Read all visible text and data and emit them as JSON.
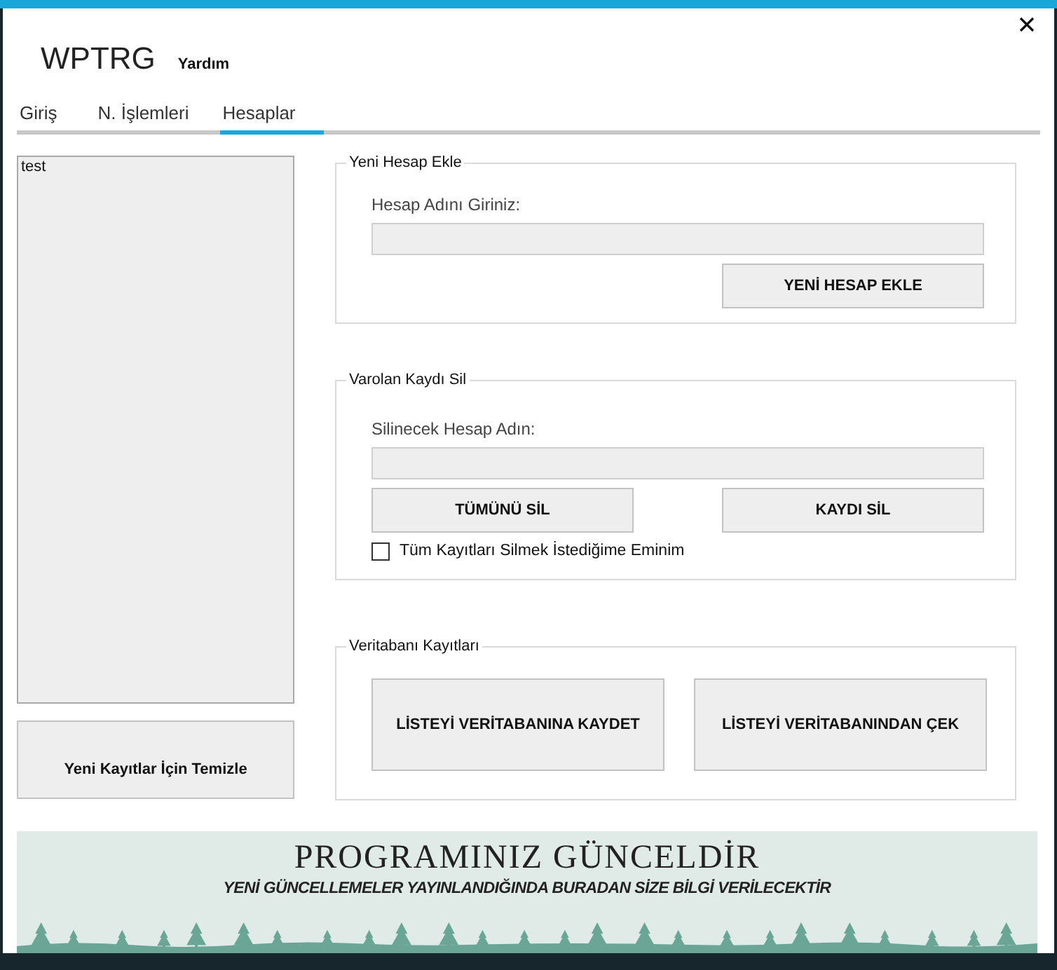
{
  "window": {
    "title": "WPTRG",
    "menu": [
      "Yardım"
    ]
  },
  "tabs": [
    {
      "label": "Giriş",
      "selected": false
    },
    {
      "label": "N. İşlemleri",
      "selected": false
    },
    {
      "label": "Hesaplar",
      "selected": true
    }
  ],
  "accounts_list": {
    "items": [
      "test"
    ]
  },
  "clear_button": "Yeni Kayıtlar İçin Temizle",
  "add_group": {
    "title": "Yeni Hesap Ekle",
    "field_label": "Hesap Adını Giriniz:",
    "button": "YENİ HESAP EKLE"
  },
  "delete_group": {
    "title": "Varolan Kaydı Sil",
    "field_label": "Silinecek Hesap Adın:",
    "buttons": [
      "TÜMÜNÜ SİL",
      "KAYDI SİL"
    ],
    "confirm": {
      "label": "Tüm Kayıtları Silmek İstediğime Eminim",
      "checked": false
    }
  },
  "database_group": {
    "title": "Veritabanı Kayıtları",
    "buttons": [
      "LİSTEYİ VERİTABANINA KAYDET",
      "LİSTEYİ VERİTABANINDAN ÇEK"
    ]
  },
  "banner": {
    "title": "PROGRAMINIZ GÜNCELDİR",
    "subtitle": "YENİ GÜNCELLEMELER YAYINLANDIĞINDA BURADAN SİZE BİLGİ VERİLECEKTİR"
  }
}
